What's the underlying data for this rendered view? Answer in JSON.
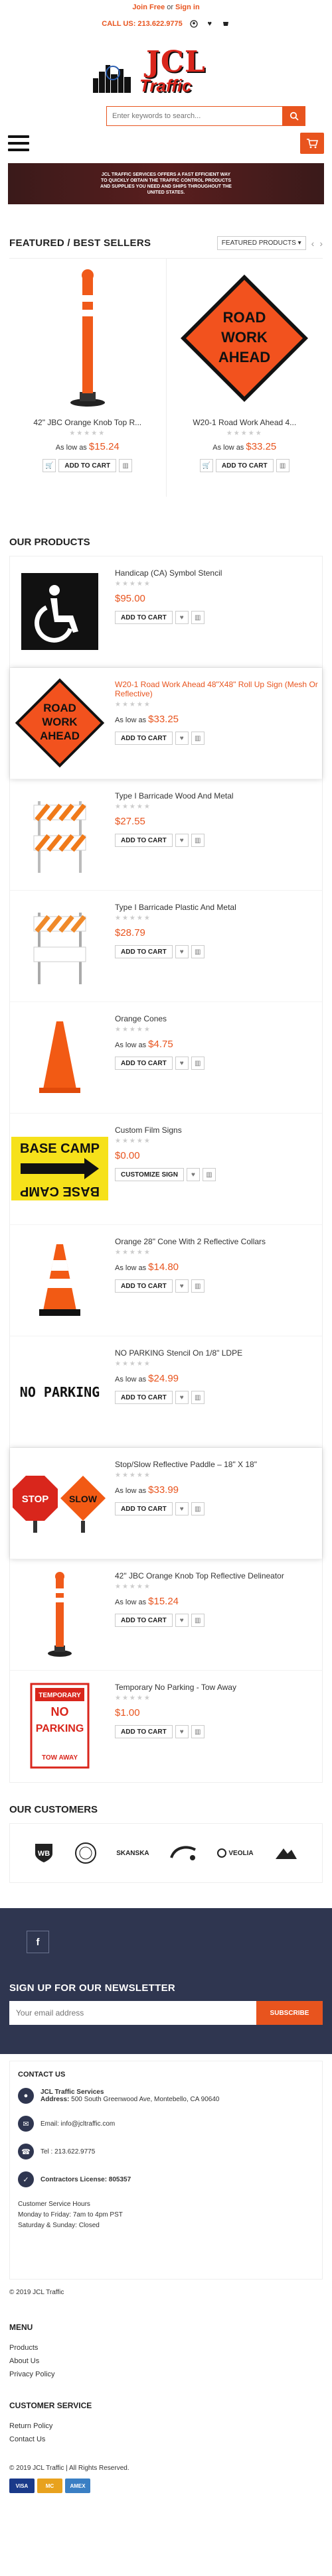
{
  "topbar": {
    "join": "Join Free",
    "or": "or",
    "signin": "Sign in"
  },
  "callbar": {
    "call": "CALL US: 213.622.9775"
  },
  "logo": {
    "line1": "JCL",
    "line2": "Traffic"
  },
  "search": {
    "placeholder": "Enter keywords to search..."
  },
  "banner": {
    "text": "JCL Traffic Services offers a fast efficient way to quickly obtain the traffic control products and supplies you need and ships throughout the United States."
  },
  "featured": {
    "title": "FEATURED / BEST SELLERS",
    "select": "FEATURED PRODUCTS",
    "items": [
      {
        "name": "42\" JBC Orange Knob Top R...",
        "as_low": "As low as",
        "price": "$15.24",
        "add": "ADD TO CART"
      },
      {
        "name": "W20-1 Road Work Ahead 4...",
        "as_low": "As low as",
        "price": "$33.25",
        "add": "ADD TO CART"
      }
    ]
  },
  "products": {
    "title": "OUR PRODUCTS",
    "items": [
      {
        "name": "Handicap (CA) Symbol Stencil",
        "as_low": "",
        "price": "$95.00",
        "add": "ADD TO CART"
      },
      {
        "name": "W20-1 Road Work Ahead 48\"X48\" Roll Up Sign (Mesh Or Reflective)",
        "as_low": "As low as",
        "price": "$33.25",
        "add": "ADD TO CART"
      },
      {
        "name": "Type I Barricade Wood And Metal",
        "as_low": "",
        "price": "$27.55",
        "add": "ADD TO CART"
      },
      {
        "name": "Type I Barricade Plastic And Metal",
        "as_low": "",
        "price": "$28.79",
        "add": "ADD TO CART"
      },
      {
        "name": "Orange Cones",
        "as_low": "As low as",
        "price": "$4.75",
        "add": "ADD TO CART"
      },
      {
        "name": "Custom Film Signs",
        "as_low": "",
        "price": "$0.00",
        "add": "CUSTOMIZE SIGN"
      },
      {
        "name": "Orange 28\" Cone With 2 Reflective Collars",
        "as_low": "As low as",
        "price": "$14.80",
        "add": "ADD TO CART"
      },
      {
        "name": "NO PARKING Stencil On 1/8\" LDPE",
        "as_low": "As low as",
        "price": "$24.99",
        "add": "ADD TO CART"
      },
      {
        "name": "Stop/Slow Reflective Paddle – 18\" X 18\"",
        "as_low": "As low as",
        "price": "$33.99",
        "add": "ADD TO CART"
      },
      {
        "name": "42\" JBC Orange Knob Top Reflective Delineator",
        "as_low": "As low as",
        "price": "$15.24",
        "add": "ADD TO CART"
      },
      {
        "name": "Temporary No Parking - Tow Away",
        "as_low": "",
        "price": "$1.00",
        "add": "ADD TO CART"
      }
    ]
  },
  "images": {
    "road_work": [
      "ROAD",
      "WORK",
      "AHEAD"
    ],
    "base_camp": "BASE CAMP",
    "no_parking": "NO PARKING",
    "stop": "STOP",
    "slow": "SLOW",
    "temp": [
      "TEMPORARY",
      "NO",
      "PARKING",
      "TOW AWAY"
    ]
  },
  "customers": {
    "title": "OUR CUSTOMERS",
    "logos": [
      "SKANSKA",
      "VEOLIA"
    ]
  },
  "newsletter": {
    "title": "SIGN UP FOR OUR NEWSLETTER",
    "placeholder": "Your email address",
    "button": "SUBSCRIBE"
  },
  "contact": {
    "title": "CONTACT US",
    "company": "JCL Traffic Services",
    "address_label": "Address:",
    "address": "500 South Greenwood Ave, Montebello, CA 90640",
    "email": "Email: info@jcltraffic.com",
    "tel": "Tel : 213.622.9775",
    "license": "Contractors License: 805357",
    "hours_title": "Customer Service Hours",
    "hours1": "Monday to Friday: 7am to 4pm PST",
    "hours2": "Saturday & Sunday: Closed"
  },
  "copyright": "© 2019 JCL Traffic",
  "menu": {
    "title": "MENU",
    "links": [
      "Products",
      "About Us",
      "Privacy Policy"
    ]
  },
  "service": {
    "title": "CUSTOMER SERVICE",
    "links": [
      "Return Policy",
      "Contact Us"
    ]
  },
  "copyright2": "© 2019 JCL Traffic | All Rights Reserved.",
  "cards": [
    "VISA",
    "MC",
    "AMEX"
  ],
  "colors": {
    "accent": "#e8541e",
    "dark": "#2f3650",
    "red": "#d9261c"
  }
}
